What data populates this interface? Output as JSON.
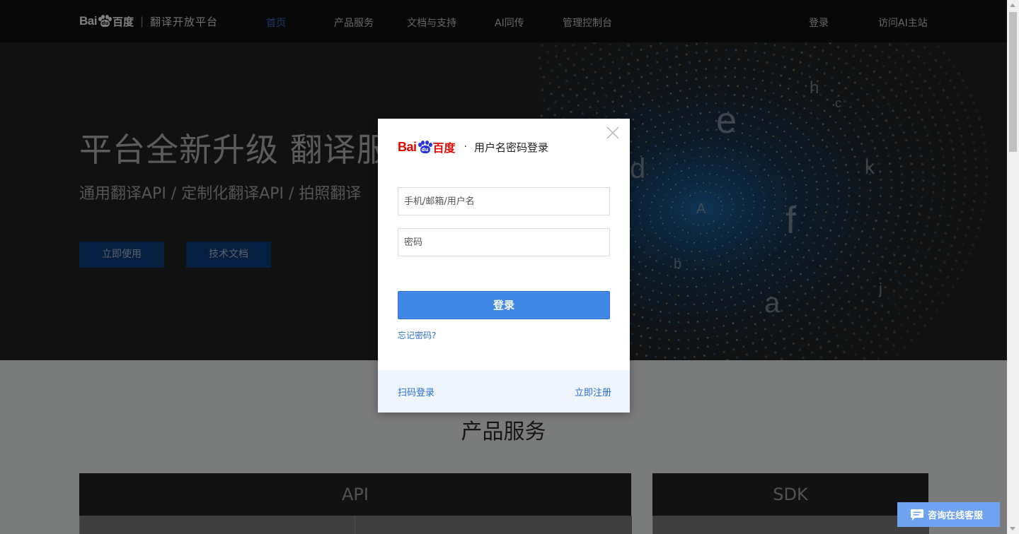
{
  "nav": {
    "brand_bai": "Bai",
    "brand_du": "du",
    "brand_baidu": "百度",
    "brand_sep": "|",
    "brand_title": "翻译开放平台",
    "items": [
      {
        "label": "首页",
        "active": true
      },
      {
        "label": "产品服务"
      },
      {
        "label": "文档与支持"
      },
      {
        "label": "AI同传"
      },
      {
        "label": "管理控制台"
      }
    ],
    "login": "登录",
    "visit_main": "访问AI主站"
  },
  "hero": {
    "title": "平台全新升级 翻译服务",
    "subtitle": "通用翻译API / 定制化翻译API / 拍照翻译",
    "primary_button": "立即使用",
    "secondary_button": "技术文档",
    "art_letters": [
      "h",
      "e",
      "d",
      "k",
      "f",
      "A",
      "a",
      "b",
      "c",
      "j"
    ]
  },
  "products": {
    "section_title": "产品服务",
    "cards": [
      "API",
      "SDK"
    ]
  },
  "login_modal": {
    "logo_bai": "Bai",
    "logo_du": "du",
    "logo_baidu": "百度",
    "separator": "·",
    "title": "用户名密码登录",
    "username_placeholder": "手机/邮箱/用户名",
    "password_placeholder": "密码",
    "submit": "登录",
    "forgot": "忘记密码?",
    "qr_login": "扫码登录",
    "register": "立即注册"
  },
  "chat": {
    "label": "咨询在线客服"
  },
  "colors": {
    "nav_bg": "#111111",
    "nav_active": "#3b6fd6",
    "hero_button": "#0b3f80",
    "login_button": "#3f88e8",
    "link": "#2a6fd0",
    "baidu_red": "#e10602",
    "baidu_blue": "#2932e1"
  }
}
